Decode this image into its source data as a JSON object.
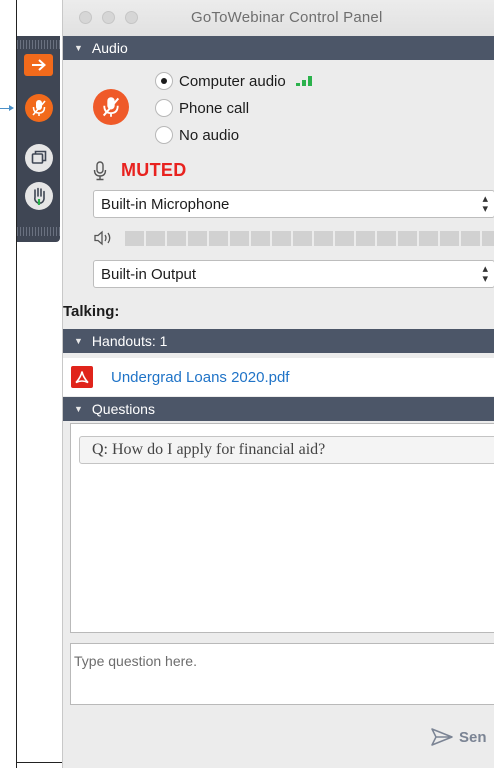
{
  "window": {
    "title": "GoToWebinar Control Panel"
  },
  "sections": {
    "audio": "Audio",
    "handouts": "Handouts: 1",
    "questions": "Questions"
  },
  "audio": {
    "options": [
      "Computer audio",
      "Phone call",
      "No audio"
    ],
    "selected_option": "Computer audio",
    "status": "MUTED",
    "microphone": "Built-in Microphone",
    "output": "Built-in Output",
    "talking_label": "Talking:"
  },
  "handouts": {
    "items": [
      "Undergrad Loans 2020.pdf"
    ]
  },
  "questions": {
    "items": [
      "Q: How do I apply for financial aid?"
    ],
    "input_placeholder": "Type question here.",
    "send_label": "Sen"
  },
  "colors": {
    "accent_orange": "#f26a1b",
    "muted_red": "#e8221f",
    "section_header": "#4c5668",
    "link_blue": "#1f73c7",
    "signal_green": "#2bb24c"
  },
  "icons": [
    "arrow-right-icon",
    "mic-muted-icon",
    "screen-icon",
    "raise-hand-icon",
    "microphone-icon",
    "speaker-icon",
    "pdf-icon",
    "send-icon"
  ]
}
